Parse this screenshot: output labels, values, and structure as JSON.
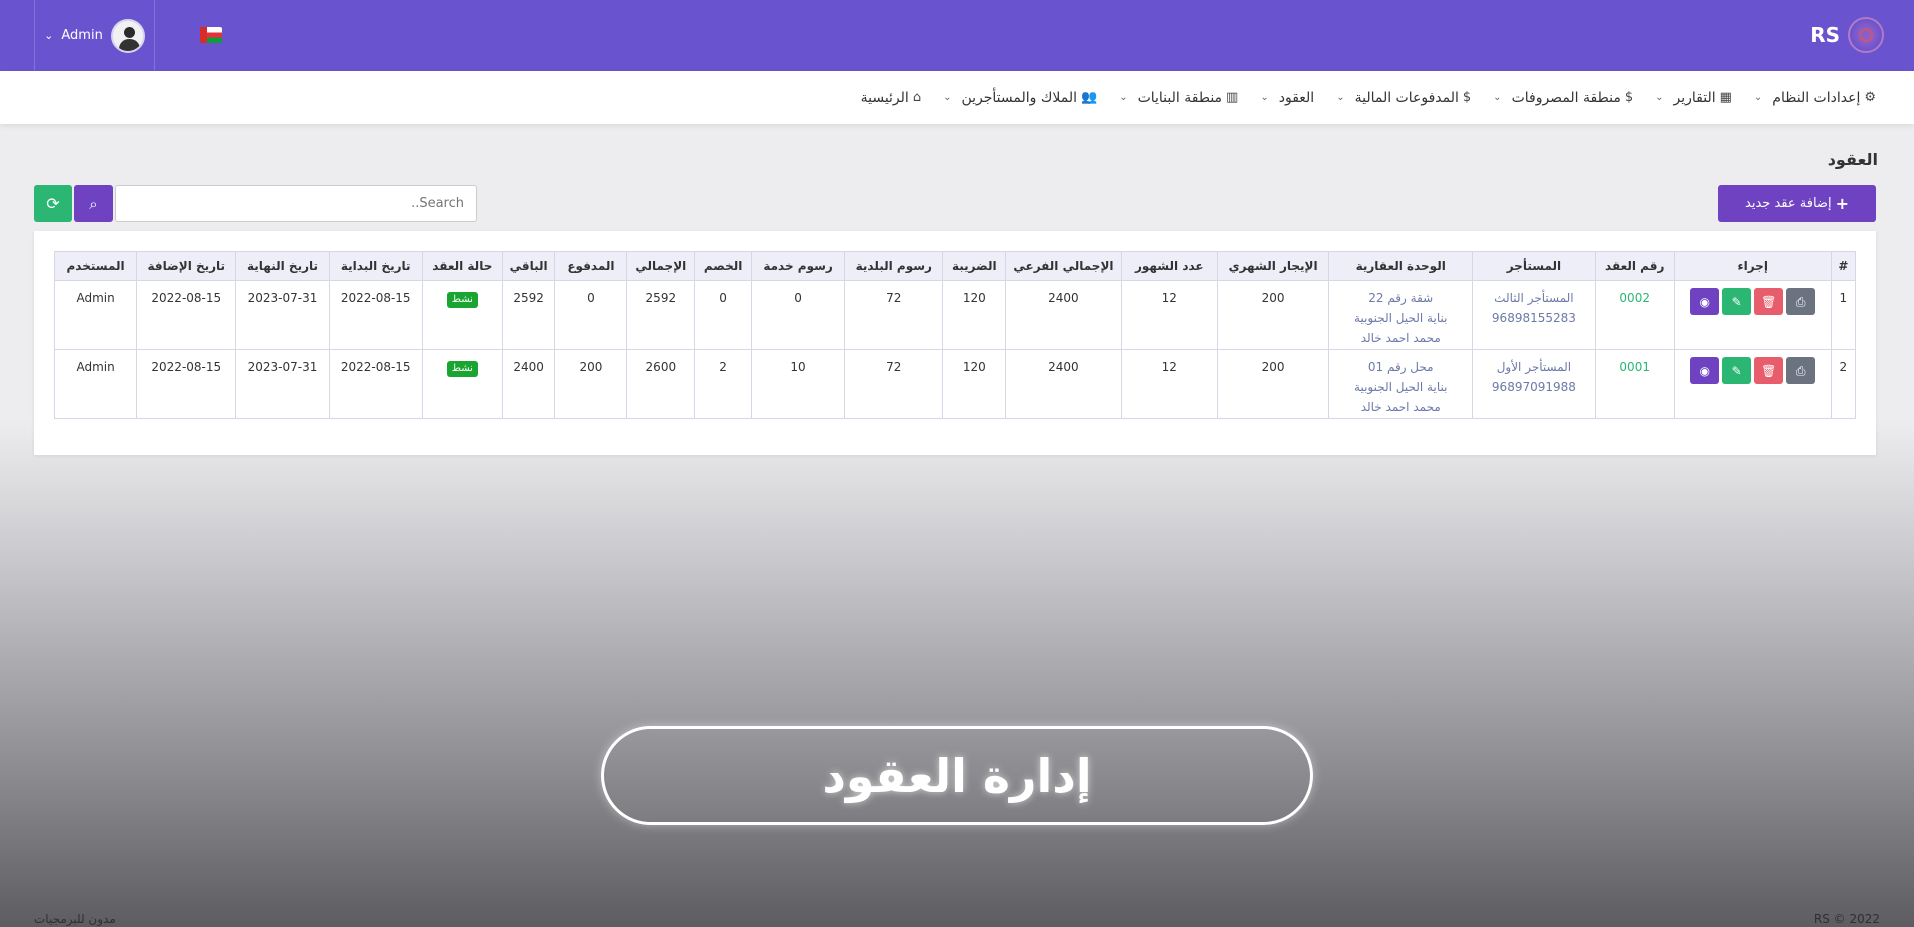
{
  "topbar": {
    "brand": "RS",
    "user_name": "Admin",
    "colors": {
      "topbar": "#6a53cf"
    }
  },
  "nav": {
    "items": [
      {
        "label": "الرئيسية",
        "icon": "home-icon"
      },
      {
        "label": "الملاك والمستأجرين",
        "icon": "users-icon"
      },
      {
        "label": "منطقة البنايات",
        "icon": "building-icon"
      },
      {
        "label": "العقود",
        "icon": ""
      },
      {
        "label": "المدفوعات المالية",
        "icon": "dollar-icon"
      },
      {
        "label": "منطقة المصروفات",
        "icon": "dollar-icon"
      },
      {
        "label": "التقارير",
        "icon": "chart-icon"
      },
      {
        "label": "إعدادات النظام",
        "icon": "gear-icon"
      }
    ]
  },
  "page": {
    "title": "العقود",
    "add_button": "إضافة عقد جديد",
    "search_placeholder": "Search.."
  },
  "table": {
    "headers": [
      "#",
      "إجراء",
      "رقم العقد",
      "المستأجر",
      "الوحدة العقارية",
      "الإيجار الشهري",
      "عدد الشهور",
      "الإجمالي الفرعي",
      "الضريبة",
      "رسوم البلدية",
      "رسوم خدمة",
      "الخصم",
      "الإجمالي",
      "المدفوع",
      "الباقي",
      "حالة العقد",
      "تاريخ البداية",
      "تاريخ النهاية",
      "تاريخ الإضافة",
      "المستخدم"
    ],
    "rows": [
      {
        "index": "1",
        "contract_no": "0002",
        "tenant_name": "المستأجر الثالث",
        "tenant_phone": "96898155283",
        "unit_line1": "شقة رقم 22",
        "unit_line2": "بناية الحيل الجنوبية",
        "unit_line3": "محمد احمد خالد",
        "monthly_rent": "200",
        "months": "12",
        "subtotal": "2400",
        "tax": "120",
        "municipality_fee": "72",
        "service_fee": "0",
        "discount": "0",
        "total": "2592",
        "paid": "0",
        "remaining": "2592",
        "status": "نشط",
        "start_date": "2022-08-15",
        "end_date": "2023-07-31",
        "added_date": "2022-08-15",
        "user": "Admin"
      },
      {
        "index": "2",
        "contract_no": "0001",
        "tenant_name": "المستأجر الأول",
        "tenant_phone": "96897091988",
        "unit_line1": "محل رقم 01",
        "unit_line2": "بناية الحيل الجنوبية",
        "unit_line3": "محمد احمد خالد",
        "monthly_rent": "200",
        "months": "12",
        "subtotal": "2400",
        "tax": "120",
        "municipality_fee": "72",
        "service_fee": "10",
        "discount": "2",
        "total": "2600",
        "paid": "200",
        "remaining": "2400",
        "status": "نشط",
        "start_date": "2022-08-15",
        "end_date": "2023-07-31",
        "added_date": "2022-08-15",
        "user": "Admin"
      }
    ]
  },
  "banner": {
    "text": "إدارة العقود"
  },
  "footer": {
    "copyright": "RS © 2022",
    "left_text": "مدون للبرمجيات"
  }
}
